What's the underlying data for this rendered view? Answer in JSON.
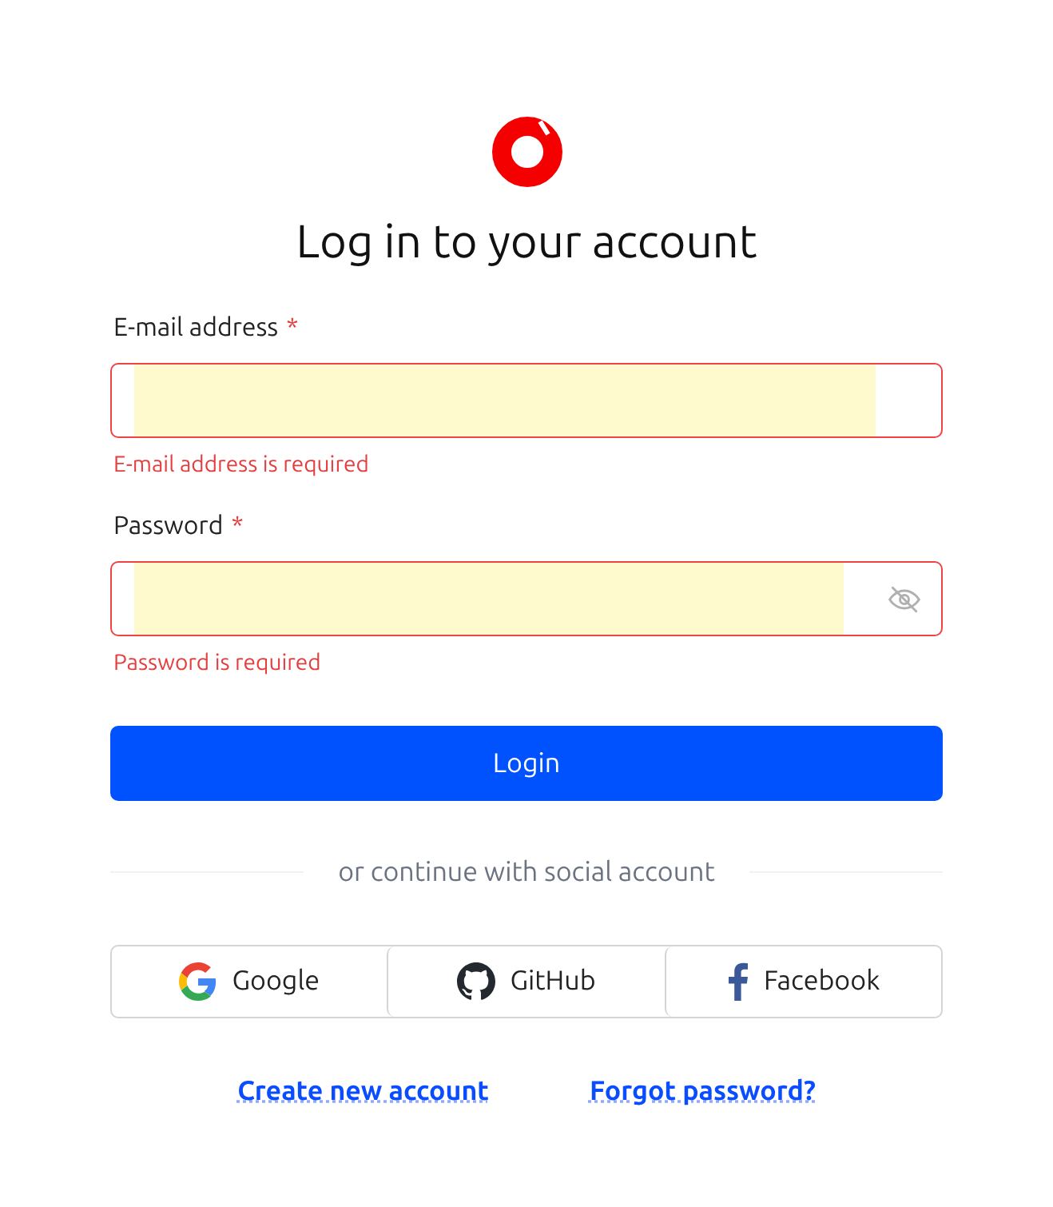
{
  "title": "Log in to your account",
  "fields": [
    {
      "kind": "email",
      "label": "E-mail address",
      "required_mark": "*",
      "invalid": true,
      "error": "E-mail address is required"
    },
    {
      "kind": "password",
      "label": "Password",
      "required_mark": "*",
      "invalid": true,
      "error": "Password is required"
    }
  ],
  "login_button": "Login",
  "divider_text": "or continue with social account",
  "social_buttons": [
    {
      "kind": "google",
      "label": "Google"
    },
    {
      "kind": "github",
      "label": "GitHub"
    },
    {
      "kind": "facebook",
      "label": "Facebook"
    }
  ],
  "links": [
    "Create new account",
    "Forgot password?"
  ]
}
